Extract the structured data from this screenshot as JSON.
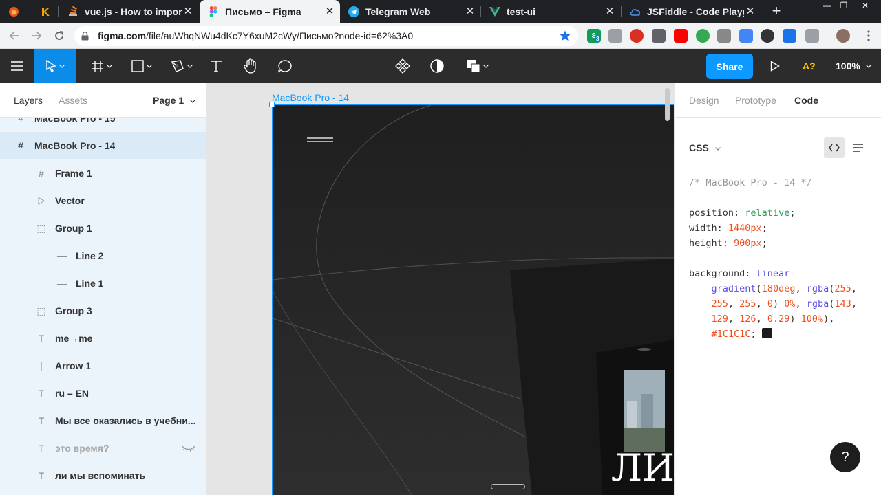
{
  "browser": {
    "tabs": [
      {
        "title": "",
        "icon": "flame-icon",
        "color": "#e25822"
      },
      {
        "title": "",
        "icon": "k-icon",
        "color": "#f4a300"
      },
      {
        "title": "vue.js - How to impor",
        "icon": "stack-icon",
        "color": "#f48024"
      },
      {
        "title": "Письмо – Figma",
        "icon": "figma-icon",
        "color": "#f24e1e"
      },
      {
        "title": "Telegram Web",
        "icon": "telegram-icon",
        "color": "#2aabee"
      },
      {
        "title": "test-ui",
        "icon": "vue-icon",
        "color": "#41b883"
      },
      {
        "title": "JSFiddle - Code Playg",
        "icon": "cloud-icon",
        "color": "#4a90e2"
      }
    ],
    "close_glyph": "✕",
    "new_tab_glyph": "+",
    "window_controls": [
      "—",
      "❐",
      "✕"
    ],
    "url_host": "figma.com",
    "url_path": "/file/auWhqNWu4dKc7Y6xuM2cWy/Письмо?node-id=62%3A0",
    "extension_badge": "3"
  },
  "toolbar": {
    "share_label": "Share",
    "font_check_label": "A?",
    "zoom_label": "100%",
    "accent": "#0d99ff"
  },
  "layers_panel": {
    "tab_layers": "Layers",
    "tab_assets": "Assets",
    "page_label": "Page 1",
    "items": [
      {
        "label": "MacBook Pro - 15",
        "icon": "frame-icon",
        "glyph": "#",
        "indent": 0
      },
      {
        "label": "MacBook Pro - 14",
        "icon": "frame-icon",
        "glyph": "#",
        "indent": 0,
        "selected": true
      },
      {
        "label": "Frame 1",
        "icon": "frame-icon",
        "glyph": "#",
        "indent": 1
      },
      {
        "label": "Vector",
        "icon": "vector-icon",
        "glyph": "⩥",
        "indent": 1
      },
      {
        "label": "Group 1",
        "icon": "group-icon",
        "glyph": "⬚",
        "indent": 1
      },
      {
        "label": "Line 2",
        "icon": "line-icon",
        "glyph": "—",
        "indent": 2
      },
      {
        "label": "Line 1",
        "icon": "line-icon",
        "glyph": "—",
        "indent": 2
      },
      {
        "label": "Group 3",
        "icon": "group-icon",
        "glyph": "⬚",
        "indent": 1
      },
      {
        "label": "me→me",
        "icon": "text-icon",
        "glyph": "T",
        "indent": 1
      },
      {
        "label": "Arrow 1",
        "icon": "arrow-line-icon",
        "glyph": "|",
        "indent": 1
      },
      {
        "label": "ru – EN",
        "icon": "text-icon",
        "glyph": "T",
        "indent": 1
      },
      {
        "label": "Мы все оказались в учебни...",
        "icon": "text-icon",
        "glyph": "T",
        "indent": 1
      },
      {
        "label": "это время?",
        "icon": "text-icon",
        "glyph": "T",
        "indent": 1,
        "hidden": true
      },
      {
        "label": "ли мы вспоминать",
        "icon": "text-icon",
        "glyph": "T",
        "indent": 1
      }
    ]
  },
  "canvas": {
    "frame_label": "MacBook Pro - 14",
    "frame_text": "ЛИ"
  },
  "right_panel": {
    "tab_design": "Design",
    "tab_prototype": "Prototype",
    "tab_code": "Code",
    "language": "CSS",
    "code": {
      "comment": "/* MacBook Pro - 14 */",
      "position_prop": "position",
      "position_val": "relative",
      "width_prop": "width",
      "width_val": "1440px",
      "height_prop": "height",
      "height_val": "900px",
      "background_prop": "background",
      "bg_fn1": "linear-",
      "bg_fn2": "gradient",
      "bg_angle": "180deg",
      "bg_rgba1": "rgba",
      "bg_c1a": "255",
      "bg_c1b": "255",
      "bg_c1c": "255",
      "bg_c1d": "0",
      "bg_p1": "0%",
      "bg_rgba2": "rgba",
      "bg_c2a": "143",
      "bg_c2b": "129",
      "bg_c2c": "126",
      "bg_c2d": "0.29",
      "bg_p2": "100%",
      "bg_hex": "#1C1C1C"
    },
    "help_label": "?"
  }
}
